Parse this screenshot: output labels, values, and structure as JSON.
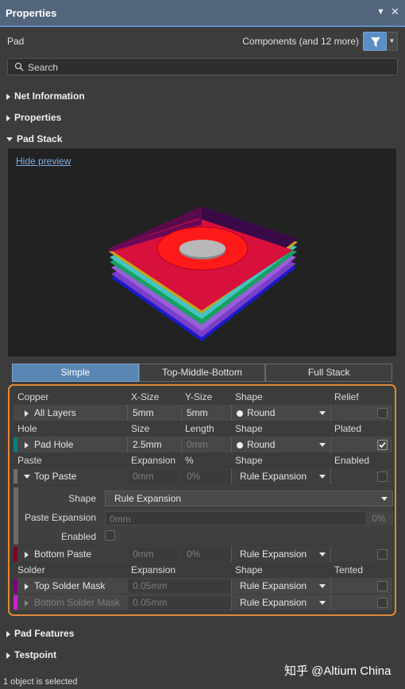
{
  "panel": {
    "title": "Properties"
  },
  "header": {
    "object_type": "Pad",
    "filter_label": "Components (and 12 more)"
  },
  "search": {
    "placeholder": "Search"
  },
  "sections": {
    "net_information": "Net Information",
    "properties": "Properties",
    "pad_stack": "Pad Stack",
    "pad_features": "Pad Features",
    "testpoint": "Testpoint"
  },
  "preview": {
    "hide_link": "Hide preview"
  },
  "stack_tabs": {
    "items": [
      "Simple",
      "Top-Middle-Bottom",
      "Full Stack"
    ],
    "selected": "Simple"
  },
  "copper": {
    "headers": [
      "Copper",
      "X-Size",
      "Y-Size",
      "Shape",
      "Relief"
    ],
    "row": {
      "layer": "All Layers",
      "x_size": "5mm",
      "y_size": "5mm",
      "shape": "Round",
      "relief": false
    }
  },
  "hole": {
    "headers": [
      "Hole",
      "Size",
      "Length",
      "Shape",
      "Plated"
    ],
    "row": {
      "name": "Pad Hole",
      "size": "2.5mm",
      "length": "0mm",
      "shape": "Round",
      "plated": true
    }
  },
  "paste": {
    "headers": [
      "Paste",
      "Expansion",
      "%",
      "Shape",
      "Enabled"
    ],
    "top": {
      "name": "Top Paste",
      "expansion": "0mm",
      "percent": "0%",
      "shape": "Rule Expansion"
    },
    "detail": {
      "shape_label": "Shape",
      "shape_value": "Rule Expansion",
      "expansion_label": "Paste Expansion",
      "expansion_value": "0mm",
      "expansion_percent": "0%",
      "enabled_label": "Enabled"
    },
    "bottom": {
      "name": "Bottom Paste",
      "expansion": "0mm",
      "percent": "0%",
      "shape": "Rule Expansion"
    }
  },
  "solder": {
    "headers": [
      "Solder",
      "Expansion",
      "Shape",
      "Tented"
    ],
    "top": {
      "name": "Top Solder Mask",
      "expansion": "0.05mm",
      "shape": "Rule Expansion"
    },
    "bottom": {
      "name": "Bottom Solder Mask",
      "expansion": "0.05mm",
      "shape": "Rule Expansion"
    }
  },
  "status": {
    "text": "1 object is selected"
  },
  "watermark": {
    "text": "知乎 @Altium China"
  },
  "colors": {
    "accent": "#5a86b4",
    "highlight_border": "#e0883a",
    "top_layer": "#ff2020",
    "paste_top": "#707070",
    "paste_bottom": "#800020",
    "solder_top": "#800080",
    "solder_bottom": "#d020d0",
    "hole_color": "#008080"
  }
}
